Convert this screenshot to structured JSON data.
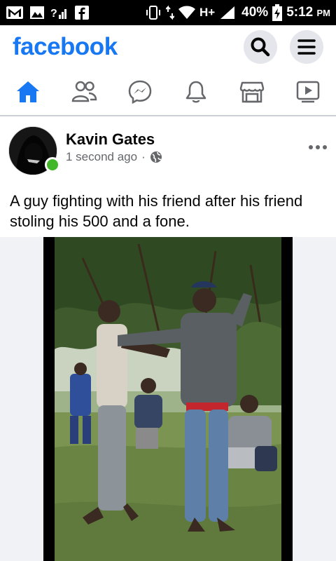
{
  "status_bar": {
    "network": "H+",
    "battery": "40%",
    "time": "5:12",
    "ampm": "PM"
  },
  "header": {
    "logo": "facebook",
    "search_icon": "search-icon",
    "menu_icon": "menu-icon"
  },
  "tabs": [
    {
      "name": "home",
      "icon": "home-icon",
      "active": true
    },
    {
      "name": "friends",
      "icon": "friends-icon"
    },
    {
      "name": "messenger",
      "icon": "messenger-icon"
    },
    {
      "name": "notifications",
      "icon": "bell-icon"
    },
    {
      "name": "marketplace",
      "icon": "store-icon"
    },
    {
      "name": "watch",
      "icon": "video-icon"
    }
  ],
  "post": {
    "author": "Kavin Gates",
    "time": "1 second ago",
    "separator": "·",
    "privacy_icon": "globe-icon",
    "text": "A guy fighting with his friend after his friend stoling his 500 and a fone."
  },
  "colors": {
    "brand": "#1877f2",
    "online": "#42b72a",
    "secondary_text": "#65676b"
  }
}
